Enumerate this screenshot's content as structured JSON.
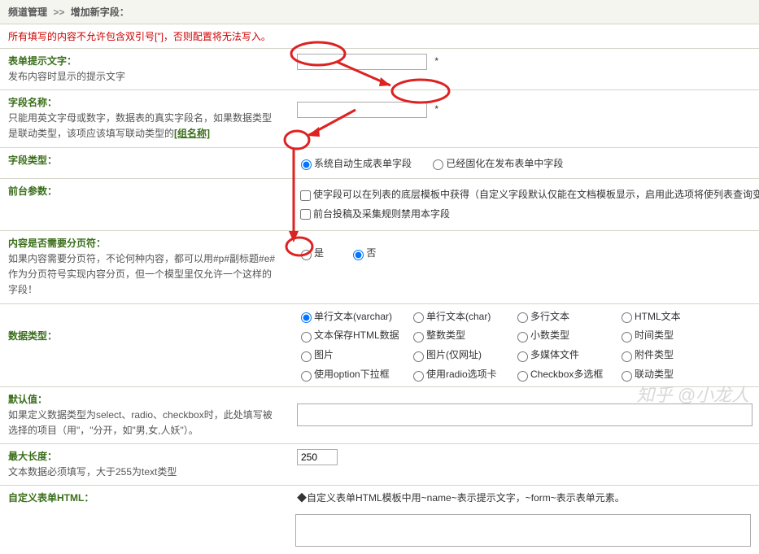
{
  "breadcrumb": {
    "a": "频道管理",
    "sep": ">>",
    "b": "增加新字段："
  },
  "warning": "所有填写的内容不允许包含双引号[\"]，否则配置将无法写入。",
  "rows": {
    "prompt": {
      "title": "表单提示文字：",
      "desc": "发布内容时显示的提示文字",
      "star": "*"
    },
    "fieldname": {
      "title": "字段名称：",
      "desc": "只能用英文字母或数字，数据表的真实字段名，如果数据类型是联动类型，该项应该填写联动类型的",
      "group": "[组名称]",
      "star": "*"
    },
    "fieldtype": {
      "title": "字段类型：",
      "opt1": "系统自动生成表单字段",
      "opt2": "已经固化在发布表单中字段"
    },
    "frontparam": {
      "title": "前台参数：",
      "opt1": "使字段可以在列表的底层模板中获得（自定义字段默认仅能在文档模板显示，启用此选项将使列表查询变慢，如无必要请不要选择）",
      "opt2": "前台投稿及采集规则禁用本字段"
    },
    "pagebreak": {
      "title": "内容是否需要分页符：",
      "desc": "如果内容需要分页符，不论何种内容，都可以用#p#副标题#e#作为分页符号实现内容分页，但一个模型里仅允许一个这样的字段！",
      "yes": "是",
      "no": "否"
    },
    "datatype": {
      "title": "数据类型：",
      "options": [
        "单行文本(varchar)",
        "单行文本(char)",
        "多行文本",
        "HTML文本",
        "文本保存HTML数据",
        "整数类型",
        "小数类型",
        "时间类型",
        "图片",
        "图片(仅网址)",
        "多媒体文件",
        "附件类型",
        "使用option下拉框",
        "使用radio选项卡",
        "Checkbox多选框",
        "联动类型"
      ]
    },
    "defaultval": {
      "title": "默认值：",
      "desc": "如果定义数据类型为select、radio、checkbox时，此处填写被选择的项目（用\"，\"分开，如\"男,女,人妖\"）。"
    },
    "maxlen": {
      "title": "最大长度：",
      "desc": "文本数据必须填写，大于255为text类型",
      "value": "250"
    },
    "customhtml": {
      "title": "自定义表单HTML：",
      "note": "◆自定义表单HTML模板中用~name~表示提示文字，~form~表示表单元素。"
    }
  },
  "watermark": "知乎 @小龙人"
}
